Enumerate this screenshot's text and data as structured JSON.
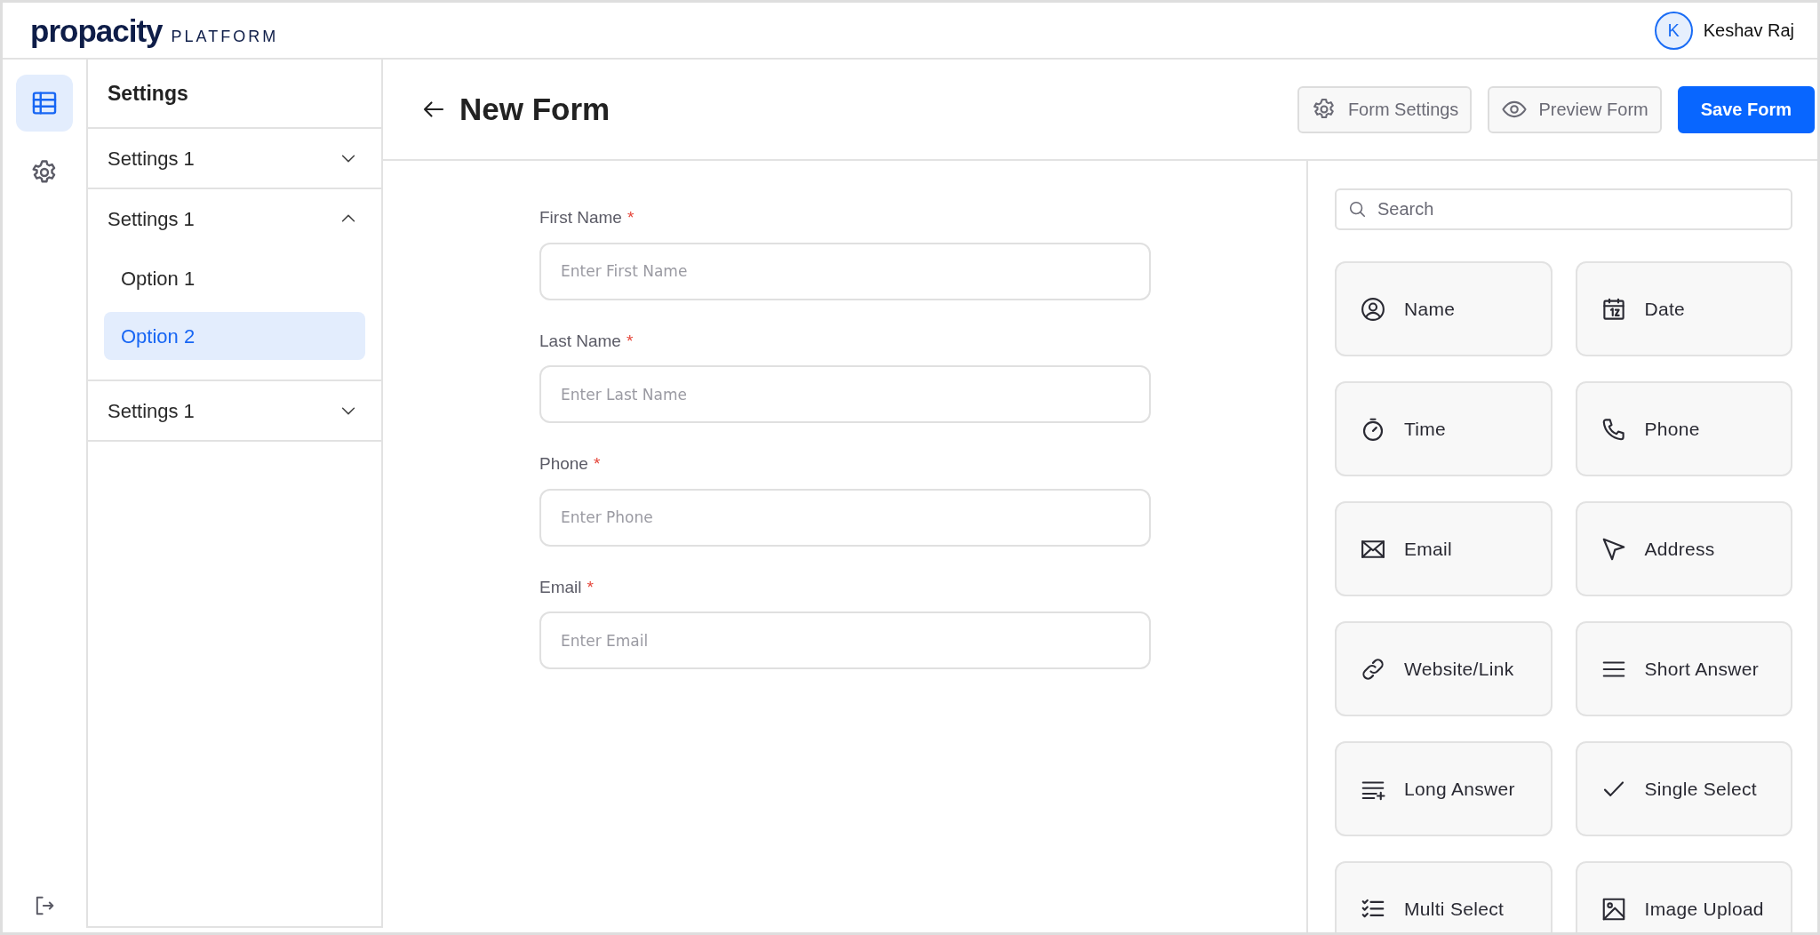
{
  "header": {
    "logo": {
      "wordmark": "propacity",
      "suffix": "PLATFORM"
    },
    "user": {
      "initial": "K",
      "name": "Keshav Raj"
    }
  },
  "rail": {
    "items": [
      {
        "selected": true
      },
      {
        "selected": false
      }
    ]
  },
  "settings_panel": {
    "title": "Settings",
    "sections": [
      {
        "label": "Settings 1",
        "expanded": false
      },
      {
        "label": "Settings 1",
        "expanded": true,
        "options": [
          {
            "label": "Option 1",
            "selected": false
          },
          {
            "label": "Option 2",
            "selected": true
          }
        ]
      },
      {
        "label": "Settings 1",
        "expanded": false
      }
    ]
  },
  "toolbar": {
    "title": "New Form",
    "buttons": [
      {
        "label": "Form Settings",
        "kind": "settings"
      },
      {
        "label": "Preview Form",
        "kind": "preview"
      },
      {
        "label": "Save Form",
        "kind": "primary"
      }
    ]
  },
  "form": {
    "fields": [
      {
        "label": "First Name",
        "required_mark": "*",
        "placeholder": "Enter First Name"
      },
      {
        "label": "Last Name",
        "required_mark": "*",
        "placeholder": "Enter Last Name"
      },
      {
        "label": "Phone",
        "required_mark": "*",
        "placeholder": "Enter Phone"
      },
      {
        "label": "Email",
        "required_mark": "*",
        "placeholder": "Enter Email"
      }
    ]
  },
  "palette": {
    "search": {
      "placeholder": "Search"
    },
    "items": [
      {
        "label": "Name"
      },
      {
        "label": "Date"
      },
      {
        "label": "Time"
      },
      {
        "label": "Phone"
      },
      {
        "label": "Email"
      },
      {
        "label": "Address"
      },
      {
        "label": "Website/Link"
      },
      {
        "label": "Short Answer"
      },
      {
        "label": "Long Answer"
      },
      {
        "label": "Single Select"
      },
      {
        "label": "Multi Select"
      },
      {
        "label": "Image Upload"
      }
    ]
  }
}
